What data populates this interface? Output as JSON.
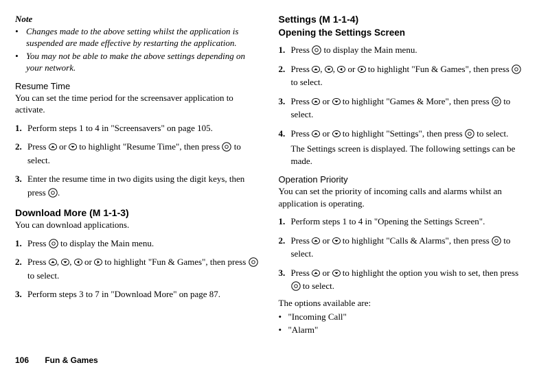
{
  "left": {
    "note_heading": "Note",
    "note_items": [
      "Changes made to the above setting whilst the application is suspended are made effective by restarting the application.",
      "You may not be able to make the above settings depending on your network."
    ],
    "resume_heading": "Resume Time",
    "resume_para": "You can set the time period for the screensaver application to activate.",
    "resume_steps": [
      {
        "n": "1.",
        "a": "Perform steps 1 to 4 in \"Screensavers\" on page 105."
      },
      {
        "n": "2.",
        "a": "Press ",
        "b": " or ",
        "c": " to highlight \"Resume Time\", then press ",
        "d": " to select."
      },
      {
        "n": "3.",
        "a": "Enter the resume time in two digits using the digit keys, then press ",
        "b": "."
      }
    ],
    "download_heading": "Download More",
    "download_code": "(M 1-1-3)",
    "download_para": "You can download applications.",
    "download_steps": [
      {
        "n": "1.",
        "a": "Press ",
        "b": " to display the Main menu."
      },
      {
        "n": "2.",
        "a": "Press ",
        "b": ", ",
        "c": ", ",
        "d": " or ",
        "e": " to highlight \"Fun & Games\", then press ",
        "f": " to select."
      },
      {
        "n": "3.",
        "a": "Perform steps 3 to 7 in \"Download More\" on page 87."
      }
    ]
  },
  "right": {
    "settings_heading": "Settings",
    "settings_code": "(M 1-1-4)",
    "open_heading": "Opening the Settings Screen",
    "open_steps": [
      {
        "n": "1.",
        "a": "Press ",
        "b": " to display the Main menu."
      },
      {
        "n": "2.",
        "a": "Press ",
        "b": ", ",
        "c": ", ",
        "d": " or ",
        "e": " to highlight \"Fun & Games\", then press ",
        "f": " to select."
      },
      {
        "n": "3.",
        "a": "Press ",
        "b": " or ",
        "c": " to highlight \"Games & More\", then press ",
        "d": " to select."
      },
      {
        "n": "4.",
        "a": "Press ",
        "b": " or ",
        "c": " to highlight \"Settings\", then press ",
        "d": " to select."
      }
    ],
    "open_followup": "The Settings screen is displayed. The following settings can be made.",
    "priority_heading": "Operation Priority",
    "priority_para": "You can set the priority of incoming calls and alarms whilst an application is operating.",
    "priority_steps": [
      {
        "n": "1.",
        "a": "Perform steps 1 to 4 in \"Opening the Settings Screen\"."
      },
      {
        "n": "2.",
        "a": "Press ",
        "b": " or ",
        "c": " to highlight \"Calls & Alarms\", then press ",
        "d": " to select."
      },
      {
        "n": "3.",
        "a": "Press ",
        "b": " or ",
        "c": " to highlight the option you wish to set, then press ",
        "d": " to select."
      }
    ],
    "options_intro": "The options available are:",
    "options": [
      "\"Incoming Call\"",
      "\"Alarm\""
    ]
  },
  "footer": {
    "page": "106",
    "title": "Fun & Games"
  }
}
